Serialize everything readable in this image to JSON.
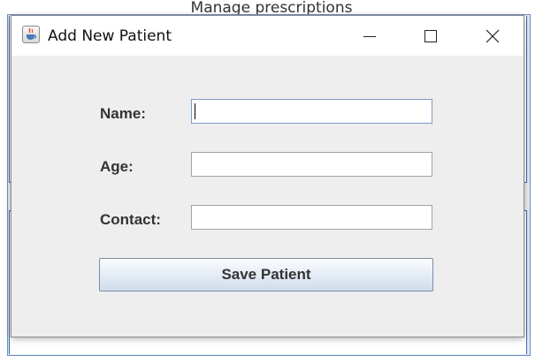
{
  "background_window": {
    "title": "Manage prescriptions"
  },
  "dialog": {
    "title": "Add New Patient",
    "icon": "java-cup-icon",
    "controls": [
      "minimize-icon",
      "maximize-icon",
      "close-icon"
    ]
  },
  "form": {
    "name_label": "Name:",
    "name_value": "",
    "age_label": "Age:",
    "age_value": "",
    "contact_label": "Contact:",
    "contact_value": "",
    "save_label": "Save Patient"
  },
  "colors": {
    "dialog_bg": "#eeeeee",
    "accent_border": "#3d6bb3",
    "button_gradient_bottom": "#cfdceb"
  }
}
